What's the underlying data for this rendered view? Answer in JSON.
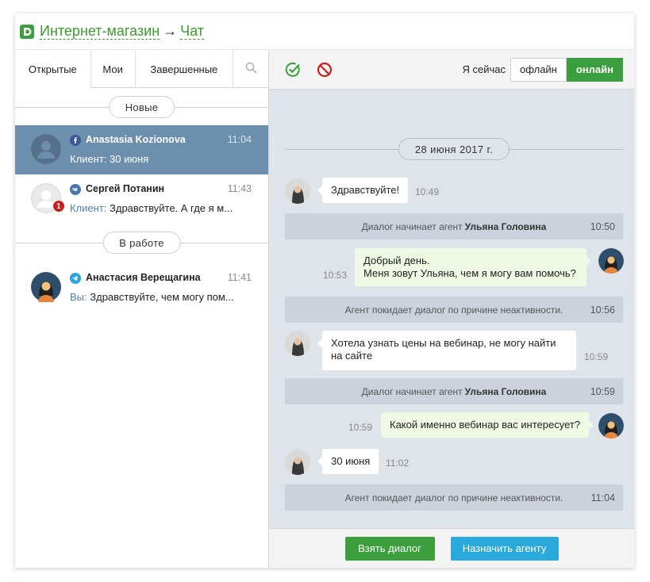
{
  "header": {
    "section": "Интернет-магазин",
    "separator": "→",
    "page": "Чат"
  },
  "tabs": [
    {
      "label": "Открытые",
      "active": true
    },
    {
      "label": "Мои",
      "active": false
    },
    {
      "label": "Завершенные",
      "active": false
    }
  ],
  "groups": {
    "new": "Новые",
    "in_work": "В работе"
  },
  "conversations": [
    {
      "name": "Anastasia Kozionova",
      "source": "facebook-icon",
      "time": "11:04",
      "who": "",
      "preview": "Клиент: 30 июня",
      "unread": "",
      "active": true
    },
    {
      "name": "Сергей Потанин",
      "source": "vk-icon",
      "time": "11:43",
      "who": "Клиент:",
      "preview": " Здравствуйте. А где я м...",
      "unread": "1",
      "active": false
    },
    {
      "name": "Анастасия Верещагина",
      "source": "telegram-icon",
      "time": "11:41",
      "who": "Вы:",
      "preview": " Здравствуйте, чем могу пом...",
      "unread": "",
      "active": false
    }
  ],
  "toolbar": {
    "status_label": "Я сейчас",
    "offline": "офлайн",
    "online": "онлайн"
  },
  "chat": {
    "date": "28 июня 2017 г.",
    "messages": [
      {
        "text": "Здравствуйте!",
        "time": "10:49"
      },
      {
        "text_before": "Диалог начинает агент",
        "agent": "Ульяна Головина",
        "time": "10:50"
      },
      {
        "line1": "Добрый день.",
        "line2": "Меня зовут Ульяна, чем я могу вам помочь?",
        "time": "10:53"
      },
      {
        "text": "Агент покидает диалог по причине неактивности.",
        "time": "10:56"
      },
      {
        "line1": "Хотела узнать цены на вебинар, не могу найти",
        "line2": "на сайте",
        "time": "10:59"
      },
      {
        "text_before": "Диалог начинает агент",
        "agent": "Ульяна Головина",
        "time": "10:59"
      },
      {
        "text": "Какой именно вебинар вас интересует?",
        "time": "10:59"
      },
      {
        "text": "30 июня",
        "time": "11:02"
      },
      {
        "text": "Агент покидает диалог по причине неактивности.",
        "time": "11:04"
      }
    ]
  },
  "footer": {
    "take": "Взять диалог",
    "assign": "Назначить агенту"
  },
  "colors": {
    "accent_green": "#3a9f3c",
    "accent_blue": "#2aa9dc",
    "active_row": "#6c8fae",
    "danger": "#c91e1e"
  }
}
